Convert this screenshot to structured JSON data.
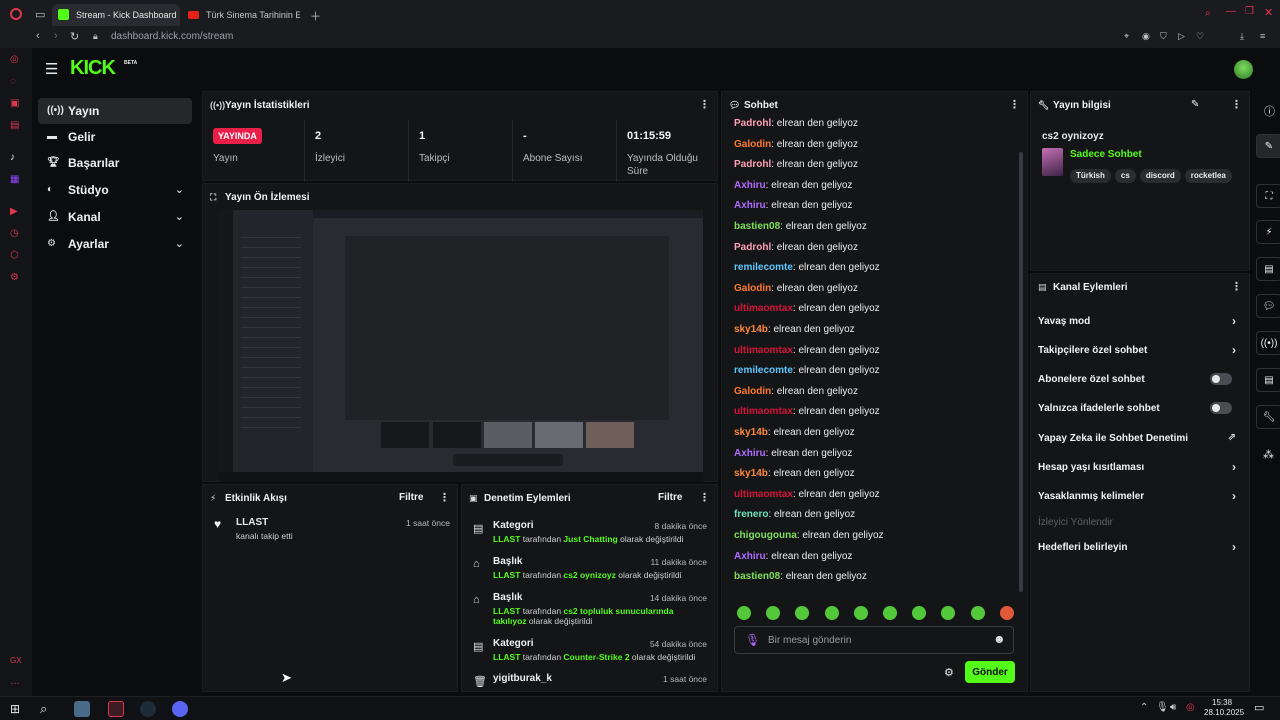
{
  "browser": {
    "tabs": [
      {
        "title": "Stream - Kick Dashboard",
        "active": true
      },
      {
        "title": "Türk Sinema Tarihinin En",
        "active": false
      }
    ],
    "address": "dashboard.kick.com/stream"
  },
  "header": {
    "logo": "KICK",
    "logo_badge": "BETA"
  },
  "sidebar": {
    "items": [
      {
        "label": "Yayın",
        "icon": "broadcast-icon"
      },
      {
        "label": "Gelir",
        "icon": "revenue-icon"
      },
      {
        "label": "Başarılar",
        "icon": "trophy-icon"
      },
      {
        "label": "Stüdyo",
        "icon": "palette-icon"
      },
      {
        "label": "Kanal",
        "icon": "user-icon"
      },
      {
        "label": "Ayarlar",
        "icon": "gear-icon"
      }
    ]
  },
  "stats_panel": {
    "title": "Yayın İstatistikleri",
    "live_badge": "YAYINDA",
    "live_label": "Yayın",
    "stats": [
      {
        "value": "2",
        "label": "İzleyici"
      },
      {
        "value": "1",
        "label": "Takipçi"
      },
      {
        "value": "-",
        "label": "Abone Sayısı"
      },
      {
        "value": "01:15:59",
        "label": "Yayında Olduğu Süre"
      }
    ]
  },
  "preview_panel": {
    "title": "Yayın Ön İzlemesi"
  },
  "activity_panel": {
    "title": "Etkinlik Akışı",
    "filter": "Filtre",
    "items": [
      {
        "user": "LLAST",
        "desc": "kanalı takip etti",
        "time": "1 saat önce"
      }
    ]
  },
  "moderation_panel": {
    "title": "Denetim Eylemleri",
    "filter": "Filtre",
    "items": [
      {
        "title": "Kategori",
        "time": "8 dakika önce",
        "user": "LLAST",
        "pre": "tarafından",
        "value": "Just Chatting",
        "post": "olarak değiştirildi"
      },
      {
        "title": "Başlık",
        "time": "11 dakika önce",
        "user": "LLAST",
        "pre": "tarafından",
        "value": "cs2 oynizoyz",
        "post": "olarak değiştirildi"
      },
      {
        "title": "Başlık",
        "time": "14 dakika önce",
        "user": "LLAST",
        "pre": "tarafından",
        "value": "cs2 topluluk sunucularında takılıyoz",
        "post": "olarak değiştirildi"
      },
      {
        "title": "Kategori",
        "time": "54 dakika önce",
        "user": "LLAST",
        "pre": "tarafından",
        "value": "Counter-Strike 2",
        "post": "olarak değiştirildi"
      },
      {
        "title": "yigitburak_k",
        "time": "1 saat önce"
      }
    ]
  },
  "chat_panel": {
    "title": "Sohbet",
    "messages": [
      {
        "user": "Padrohl",
        "text": "elrean den geliyoz",
        "color": "#ff9fb8"
      },
      {
        "user": "Galodin",
        "text": "elrean den geliyoz",
        "color": "#ff7a2e"
      },
      {
        "user": "Padrohl",
        "text": "elrean den geliyoz",
        "color": "#ff9fb8"
      },
      {
        "user": "Axhiru",
        "text": "elrean den geliyoz",
        "color": "#b06bff"
      },
      {
        "user": "Axhiru",
        "text": "elrean den geliyoz",
        "color": "#b06bff"
      },
      {
        "user": "bastien08",
        "text": "elrean den geliyoz",
        "color": "#7ee05a"
      },
      {
        "user": "Padrohl",
        "text": "elrean den geliyoz",
        "color": "#ff9fb8"
      },
      {
        "user": "remilecomte",
        "text": "elrean den geliyoz",
        "color": "#5ec8ff"
      },
      {
        "user": "Galodin",
        "text": "elrean den geliyoz",
        "color": "#ff7a2e"
      },
      {
        "user": "ultimaomtax",
        "text": "elrean den geliyoz",
        "color": "#d4143b"
      },
      {
        "user": "sky14b",
        "text": "elrean den geliyoz",
        "color": "#ff8a3a"
      },
      {
        "user": "ultimaomtax",
        "text": "elrean den geliyoz",
        "color": "#d4143b"
      },
      {
        "user": "remilecomte",
        "text": "elrean den geliyoz",
        "color": "#5ec8ff"
      },
      {
        "user": "Galodin",
        "text": "elrean den geliyoz",
        "color": "#ff7a2e"
      },
      {
        "user": "ultimaomtax",
        "text": "elrean den geliyoz",
        "color": "#d4143b"
      },
      {
        "user": "sky14b",
        "text": "elrean den geliyoz",
        "color": "#ff8a3a"
      },
      {
        "user": "Axhiru",
        "text": "elrean den geliyoz",
        "color": "#b06bff"
      },
      {
        "user": "sky14b",
        "text": "elrean den geliyoz",
        "color": "#ff8a3a"
      },
      {
        "user": "ultimaomtax",
        "text": "elrean den geliyoz",
        "color": "#d4143b"
      },
      {
        "user": "frenero",
        "text": "elrean den geliyoz",
        "color": "#6fe3c0"
      },
      {
        "user": "chigougouna",
        "text": "elrean den geliyoz",
        "color": "#7ee05a"
      },
      {
        "user": "Axhiru",
        "text": "elrean den geliyoz",
        "color": "#b06bff"
      },
      {
        "user": "bastien08",
        "text": "elrean den geliyoz",
        "color": "#7ee05a"
      }
    ],
    "input_placeholder": "Bir mesaj gönderin",
    "send_label": "Gönder"
  },
  "stream_info": {
    "title": "Yayın bilgisi",
    "stream_title": "cs2 oynizoyz",
    "mode": "Sadece Sohbet",
    "tags": [
      "Türkish",
      "cs",
      "discord",
      "rocketlea"
    ]
  },
  "channel_actions": {
    "title": "Kanal Eylemleri",
    "items": [
      {
        "label": "Yavaş mod",
        "control": "arrow"
      },
      {
        "label": "Takipçilere özel sohbet",
        "control": "arrow"
      },
      {
        "label": "Abonelere özel sohbet",
        "control": "toggle"
      },
      {
        "label": "Yalnızca ifadelerle sohbet",
        "control": "toggle"
      },
      {
        "label": "Yapay Zeka ile Sohbet Denetimi",
        "control": "external"
      },
      {
        "label": "Hesap yaşı kısıtlaması",
        "control": "arrow"
      },
      {
        "label": "Yasaklanmış kelimeler",
        "control": "arrow"
      },
      {
        "label": "İzleyici Yönlendir",
        "control": "disabled"
      },
      {
        "label": "Hedefleri belirleyin",
        "control": "arrow"
      }
    ]
  },
  "taskbar": {
    "time": "15:38",
    "date": "28.10.2025"
  },
  "colors": {
    "accent": "#53fc18",
    "live": "#e91f4a",
    "panel": "#141517"
  }
}
